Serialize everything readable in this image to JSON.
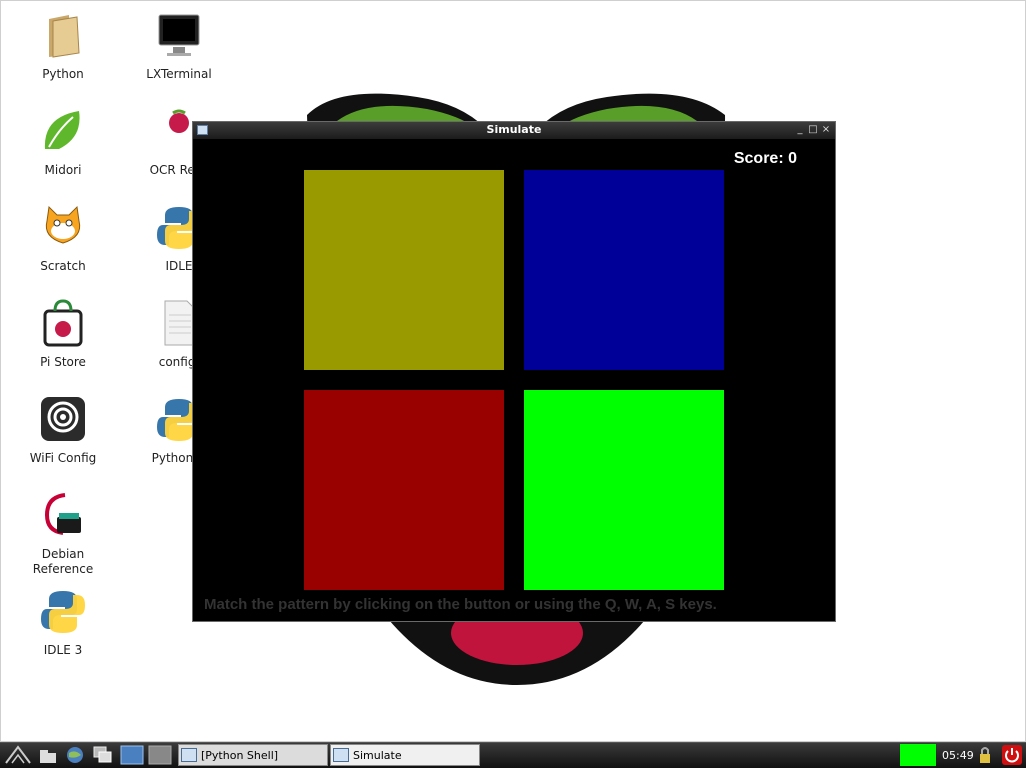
{
  "desktop": {
    "icons": [
      {
        "label": "Python",
        "icon": "folder-icon"
      },
      {
        "label": "LXTerminal",
        "icon": "monitor-icon"
      },
      {
        "label": "Midori",
        "icon": "midori-leaf-icon"
      },
      {
        "label": "OCR Reso",
        "icon": "raspberry-ocr-icon"
      },
      {
        "label": "Scratch",
        "icon": "scratch-cat-icon"
      },
      {
        "label": "IDLE",
        "icon": "python-logo-icon"
      },
      {
        "label": "Pi Store",
        "icon": "pi-store-bag-icon"
      },
      {
        "label": "config.",
        "icon": "text-file-icon"
      },
      {
        "label": "WiFi Config",
        "icon": "wifi-config-icon"
      },
      {
        "label": "Python G",
        "icon": "python-logo-icon"
      },
      {
        "label": "Debian",
        "label2": "Reference",
        "icon": "debian-reference-icon"
      },
      {
        "label": "IDLE 3",
        "icon": "python-logo-icon"
      }
    ]
  },
  "window": {
    "title": "Simulate",
    "controls": {
      "minimize": "_",
      "maximize": "□",
      "close": "×"
    },
    "score_label": "Score: 0",
    "pads": [
      {
        "key": "Q",
        "color": "#999900"
      },
      {
        "key": "W",
        "color": "#000099"
      },
      {
        "key": "A",
        "color": "#990000"
      },
      {
        "key": "S",
        "color": "#00ff00"
      }
    ],
    "hint": "Match the pattern by clicking on the button or using the Q, W, A, S keys."
  },
  "taskbar": {
    "tasks": [
      {
        "label": "[Python Shell]",
        "active": false
      },
      {
        "label": "Simulate",
        "active": true
      }
    ],
    "cpu_color": "#00ff00",
    "clock": "05:49"
  }
}
